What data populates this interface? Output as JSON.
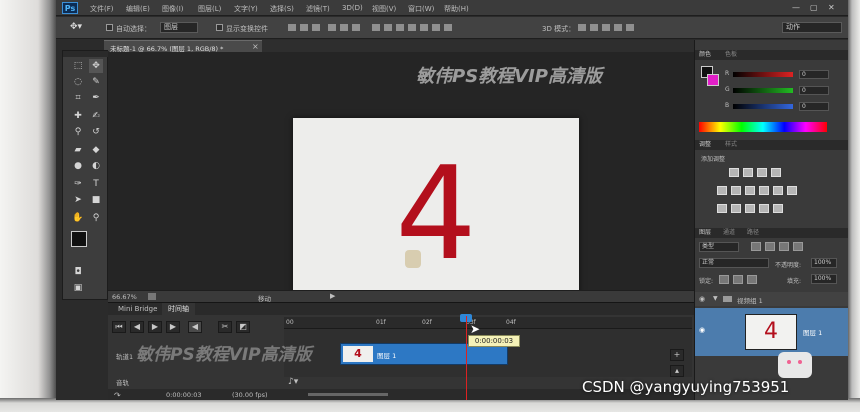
{
  "menubar": {
    "logo": "Ps",
    "items": [
      "文件(F)",
      "编辑(E)",
      "图像(I)",
      "图层(L)",
      "文字(Y)",
      "选择(S)",
      "滤镜(T)",
      "3D(D)",
      "视图(V)",
      "窗口(W)",
      "帮助(H)"
    ],
    "window_buttons": [
      "—",
      "▢",
      "✕"
    ]
  },
  "options": {
    "auto_select_label": "自动选择：",
    "auto_select_value": "图层",
    "show_transform_label": "显示变换控件",
    "mode_3d_label": "3D 模式：",
    "workspace_value": "动作"
  },
  "document": {
    "tab_title": "未标题-1 @ 66.7% (图层 1, RGB/8) *",
    "tab_close": "×",
    "canvas_text": "4"
  },
  "watermark": "敏伟PS教程VIP高清版",
  "status": {
    "zoom": "66.67%",
    "mode": "移动"
  },
  "timeline": {
    "tabs": [
      "Mini Bridge",
      "时间轴"
    ],
    "ruler_labels": [
      "00",
      "01f",
      "02f",
      "03f",
      "04f"
    ],
    "tooltip": "0:00:00:03",
    "clip_thumb": "4",
    "track_name": "视频组 1",
    "track_name_short": "轨道1",
    "audio_label": "音轨",
    "time_value": "0:00:00:03",
    "fps_value": "(30.00 fps)"
  },
  "panels": {
    "color_tab": "颜色",
    "swatch_tab": "色板",
    "channels": [
      {
        "label": "R",
        "value": "0",
        "color": "#d22"
      },
      {
        "label": "G",
        "value": "0",
        "color": "#2b2"
      },
      {
        "label": "B",
        "value": "0",
        "color": "#36d"
      }
    ],
    "adjust_tab": "调整",
    "styles_tab": "样式",
    "adjust_label": "添加调整",
    "layers_tabs": [
      "图层",
      "通道",
      "路径"
    ],
    "kind_value": "类型",
    "blend_value": "正常",
    "opacity_label": "不透明度:",
    "opacity_value": "100%",
    "lock_label": "锁定:",
    "fill_label": "填充:",
    "fill_value": "100%",
    "group_name": "视频组 1",
    "layer_name": "图层 1",
    "layer_thumb": "4"
  },
  "colors": {
    "foreground": "#111111",
    "background": "#e21fc8",
    "accent_red": "#b30f1c",
    "clip_blue": "#2d78c4"
  },
  "credit": "CSDN @yangyuying753951"
}
